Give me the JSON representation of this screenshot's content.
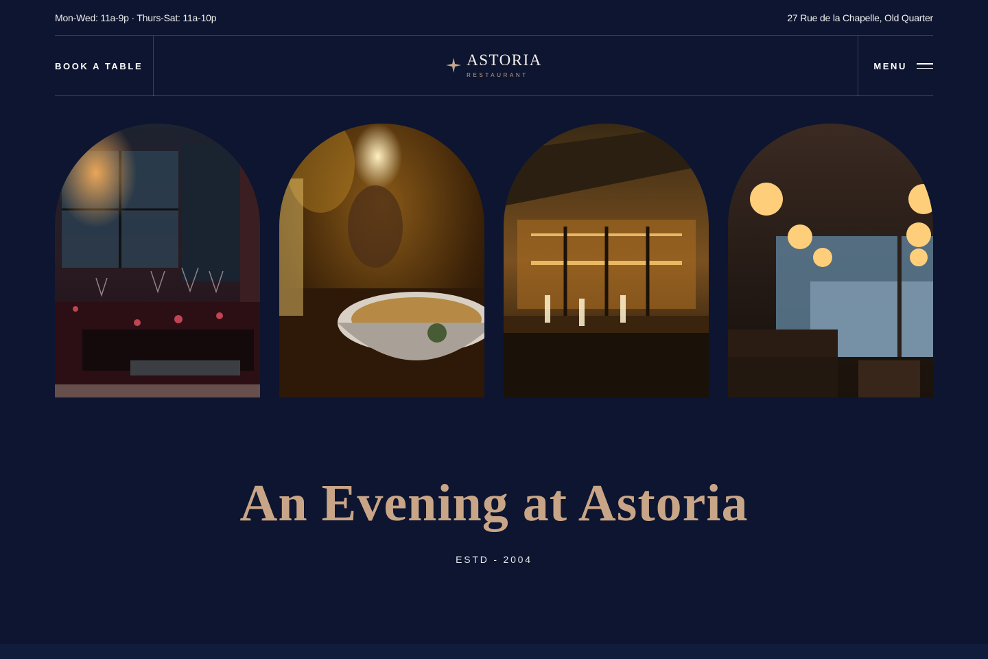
{
  "topbar": {
    "hours": "Mon-Wed: 11a-9p · Thurs-Sat: 11a-10p",
    "address": "27 Rue de la Chapelle, Old Quarter"
  },
  "nav": {
    "book_label": "BOOK A TABLE",
    "menu_label": "MENU",
    "logo_name": "ASTORIA",
    "logo_sub": "RESTAURANT"
  },
  "gallery": {
    "images": [
      {
        "name": "dining-room-photo",
        "icon": "photo"
      },
      {
        "name": "plated-dish-photo",
        "icon": "photo"
      },
      {
        "name": "bar-counter-photo",
        "icon": "photo"
      },
      {
        "name": "lantern-lounge-photo",
        "icon": "photo"
      }
    ]
  },
  "hero": {
    "title": "An Evening at Astoria",
    "subtitle": "ESTD - 2004"
  },
  "colors": {
    "background": "#0d1530",
    "accent": "#c9a587",
    "text": "#ffffff"
  }
}
